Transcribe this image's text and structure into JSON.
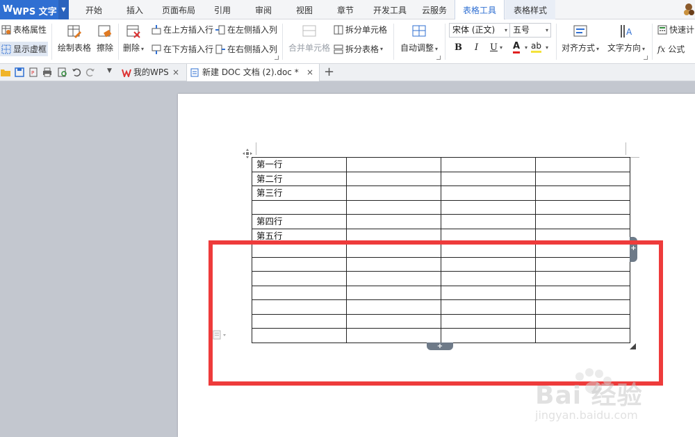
{
  "app": {
    "logo": "W",
    "name": "WPS 文字"
  },
  "menu": {
    "tabs": [
      "开始",
      "插入",
      "页面布局",
      "引用",
      "审阅",
      "视图",
      "章节",
      "开发工具",
      "云服务",
      "表格工具",
      "表格样式"
    ],
    "active": "表格工具"
  },
  "ribbon": {
    "table_props": "表格属性",
    "show_grid": "显示虚框",
    "draw_table": "绘制表格",
    "erase": "擦除",
    "delete": "删除",
    "insert_above": "在上方插入行",
    "insert_below": "在下方插入行",
    "insert_left": "在左侧插入列",
    "insert_right": "在右侧插入列",
    "merge_cells": "合并单元格",
    "split_cells": "拆分单元格",
    "split_table": "拆分表格",
    "auto_fit": "自动调整",
    "font_name": "宋体 (正文)",
    "font_size": "五号",
    "bold": "B",
    "italic": "I",
    "underline": "U",
    "font_color": "A",
    "highlight": "ab",
    "align": "对齐方式",
    "text_direction": "文字方向",
    "quick_calc": "快速计",
    "formula": "公式",
    "fx": "fx"
  },
  "doc_tabs": [
    {
      "label": "我的WPS",
      "close": "×"
    },
    {
      "label": "新建 DOC 文档 (2).doc *",
      "close": "×"
    }
  ],
  "add_tab": "+",
  "table": {
    "rows": [
      [
        "第一行",
        "",
        "",
        ""
      ],
      [
        "第二行",
        "",
        "",
        ""
      ],
      [
        "第三行",
        "",
        "",
        ""
      ],
      [
        "",
        "",
        "",
        ""
      ],
      [
        "第四行",
        "",
        "",
        ""
      ],
      [
        "第五行",
        "",
        "",
        ""
      ],
      [
        "",
        "",
        "",
        ""
      ],
      [
        "",
        "",
        "",
        ""
      ],
      [
        "",
        "",
        "",
        ""
      ],
      [
        "",
        "",
        "",
        ""
      ],
      [
        "",
        "",
        "",
        ""
      ],
      [
        "",
        "",
        "",
        ""
      ],
      [
        "",
        "",
        "",
        ""
      ]
    ]
  },
  "handles": {
    "add_row": "+",
    "add_col": "+"
  },
  "watermark": {
    "text": "Bai 经验",
    "url": "jingyan.baidu.com"
  },
  "colors": {
    "accent": "#2f6fd2",
    "highlight_border": "#ee3b3b"
  }
}
